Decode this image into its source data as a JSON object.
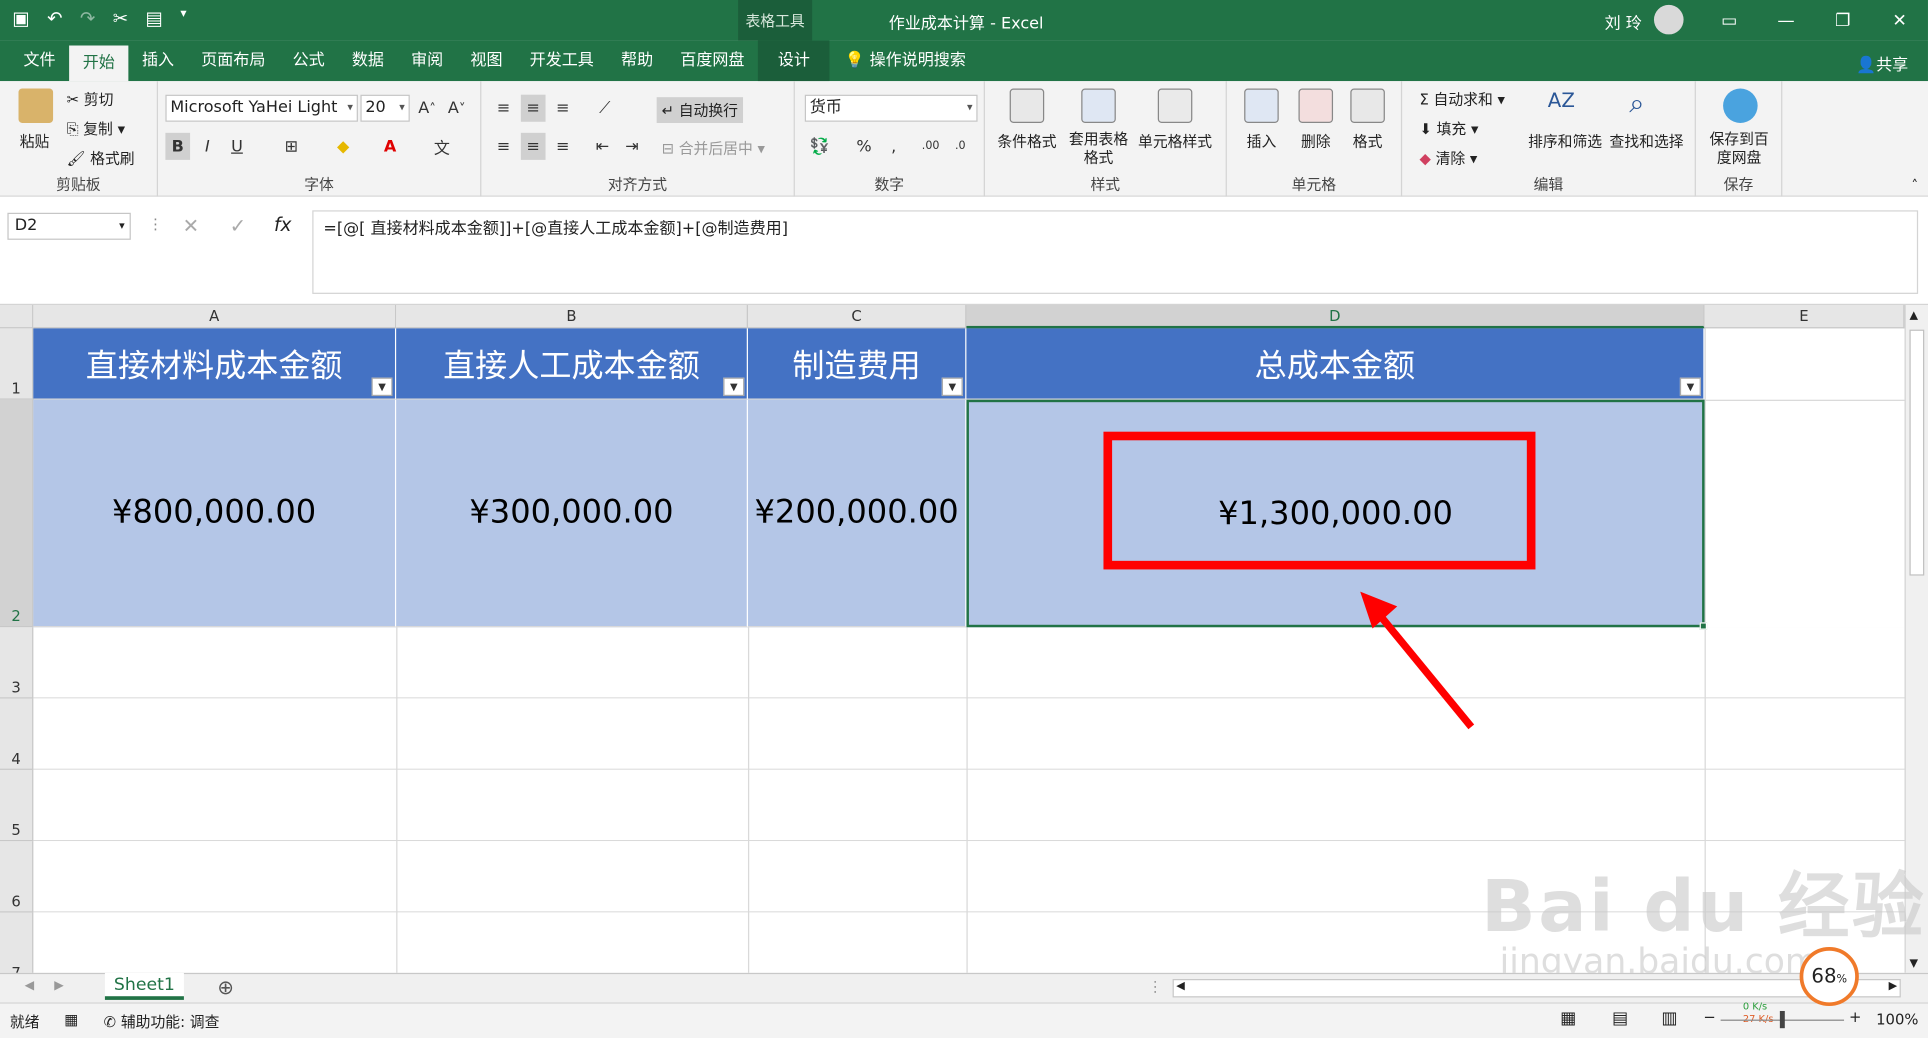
{
  "titlebar": {
    "tools": "表格工具",
    "title": "作业成本计算 - Excel",
    "user": "刘 玲"
  },
  "tabs": [
    {
      "label": "文件"
    },
    {
      "label": "开始"
    },
    {
      "label": "插入"
    },
    {
      "label": "页面布局"
    },
    {
      "label": "公式"
    },
    {
      "label": "数据"
    },
    {
      "label": "审阅"
    },
    {
      "label": "视图"
    },
    {
      "label": "开发工具"
    },
    {
      "label": "帮助"
    },
    {
      "label": "百度网盘"
    },
    {
      "label": "设计"
    }
  ],
  "tell_me": "操作说明搜索",
  "share": "共享",
  "ribbon": {
    "clipboard": {
      "paste": "粘贴",
      "cut": "剪切",
      "copy": "复制",
      "format_painter": "格式刷",
      "label": "剪贴板"
    },
    "font": {
      "name": "Microsoft YaHei Light",
      "size": "20",
      "bold": "B",
      "italic": "I",
      "underline": "U",
      "label": "字体"
    },
    "alignment": {
      "wrap": "自动换行",
      "merge": "合并后居中",
      "label": "对齐方式"
    },
    "number": {
      "format": "货币",
      "percent": "%",
      "comma": ",",
      "label": "数字"
    },
    "styles": {
      "conditional": "条件格式",
      "table": "套用表格格式",
      "cell": "单元格样式",
      "label": "样式"
    },
    "cells": {
      "insert": "插入",
      "delete": "删除",
      "format": "格式",
      "label": "单元格"
    },
    "editing": {
      "autosum": "自动求和",
      "fill": "填充",
      "clear": "清除",
      "sort": "排序和筛选",
      "find": "查找和选择",
      "label": "编辑"
    },
    "save": {
      "btn": "保存到百度网盘",
      "label": "保存"
    }
  },
  "formula_bar": {
    "name_box": "D2",
    "fx": "fx",
    "formula": "=[@[ 直接材料成本金额]]+[@直接人工成本金额]+[@制造费用]"
  },
  "grid": {
    "columns": [
      "A",
      "B",
      "C",
      "D",
      "E"
    ],
    "rows": [
      "1",
      "2",
      "3",
      "4",
      "5",
      "6",
      "7"
    ],
    "headers": [
      "直接材料成本金额",
      "直接人工成本金额",
      "制造费用",
      "总成本金额"
    ],
    "values": [
      "¥800,000.00",
      "¥300,000.00",
      "¥200,000.00",
      "¥1,300,000.00"
    ]
  },
  "sheet": {
    "tab": "Sheet1"
  },
  "status": {
    "ready": "就绪",
    "accessibility": "辅助功能: 调查",
    "zoom": "100%",
    "speed_up": "0 K/s",
    "speed_down": "27 K/s",
    "gauge": "68"
  },
  "watermark": {
    "main": "Bai du 经验",
    "url": "jingyan.baidu.com"
  }
}
